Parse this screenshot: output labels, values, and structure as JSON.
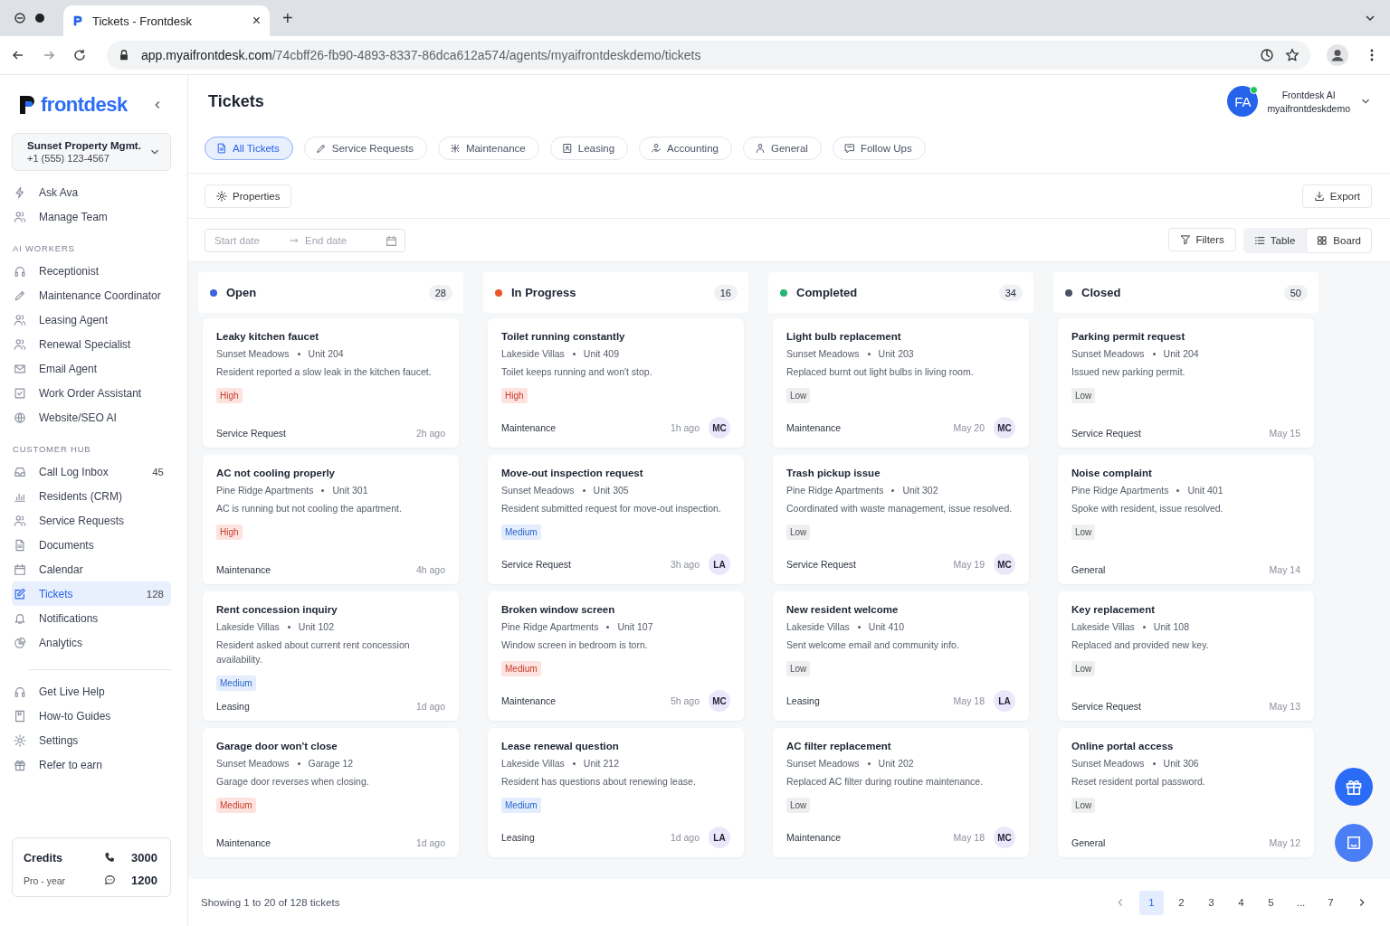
{
  "browser": {
    "tab_title": "Tickets - Frontdesk",
    "close": "×",
    "new_tab": "+",
    "url_host": "app.myaifrontdesk.com",
    "url_path": "/74cbff26-fb90-4893-8337-86dca612a574/agents/myaifrontdeskdemo/tickets"
  },
  "sidebar": {
    "logo": "frontdesk",
    "org": {
      "name": "Sunset Property Mgmt.",
      "phone": "+1 (555) 123-4567"
    },
    "top_items": [
      {
        "label": "Ask Ava",
        "selected": false
      },
      {
        "label": "Manage Team",
        "selected": false
      }
    ],
    "sections": [
      {
        "title": "AI WORKERS",
        "items": [
          {
            "label": "Receptionist",
            "selected": false
          },
          {
            "label": "Maintenance Coordinator",
            "selected": false
          },
          {
            "label": "Leasing Agent",
            "selected": false
          },
          {
            "label": "Renewal Specialist",
            "selected": false
          },
          {
            "label": "Email Agent",
            "selected": false
          },
          {
            "label": "Work Order Assistant",
            "selected": false
          },
          {
            "label": "Website/SEO AI",
            "selected": false
          }
        ]
      },
      {
        "title": "CUSTOMER HUB",
        "items": [
          {
            "label": "Call Log Inbox",
            "count": "45",
            "selected": false
          },
          {
            "label": "Residents (CRM)",
            "selected": false
          },
          {
            "label": "Service Requests",
            "selected": false
          },
          {
            "label": "Documents",
            "selected": false
          },
          {
            "label": "Calendar",
            "selected": false
          },
          {
            "label": "Tickets",
            "count": "128",
            "selected": true
          },
          {
            "label": "Notifications",
            "selected": false
          },
          {
            "label": "Analytics",
            "selected": false
          }
        ]
      }
    ],
    "bottom_items": [
      {
        "label": "Get Live Help",
        "selected": false
      },
      {
        "label": "How-to Guides",
        "selected": false
      },
      {
        "label": "Settings",
        "selected": false
      },
      {
        "label": "Refer to earn",
        "selected": false
      }
    ],
    "credits": {
      "title": "Credits",
      "plan": "Pro - year",
      "calls": "3000",
      "messages": "1200"
    }
  },
  "header": {
    "title": "Tickets",
    "user": {
      "initials": "FA",
      "name": "Frontdesk AI",
      "account": "myaifrontdeskdemo",
      "online": true
    }
  },
  "tabs": [
    {
      "label": "All Tickets",
      "selected": true
    },
    {
      "label": "Service Requests",
      "selected": false
    },
    {
      "label": "Maintenance",
      "selected": false
    },
    {
      "label": "Leasing",
      "selected": false
    },
    {
      "label": "Accounting",
      "selected": false
    },
    {
      "label": "General",
      "selected": false
    },
    {
      "label": "Follow Ups",
      "selected": false
    }
  ],
  "properties_button": "Properties",
  "export_button": "Export",
  "date_range": {
    "start_placeholder": "Start date",
    "end_placeholder": "End date"
  },
  "filters_button": "Filters",
  "views": [
    {
      "label": "Table",
      "selected": false
    },
    {
      "label": "Board",
      "selected": true
    }
  ],
  "columns": [
    {
      "title": "Open",
      "count": "28",
      "color": "#3b63e0",
      "cards": [
        {
          "title": "Leaky kitchen faucet",
          "property": "Sunset Meadows",
          "unit": "Unit 204",
          "description": "Resident reported a slow leak in the kitchen faucet.",
          "priority": "High",
          "color": "#fde3e0",
          "category": "Service Request",
          "time": "2h ago"
        },
        {
          "title": "AC not cooling properly",
          "property": "Pine Ridge Apartments",
          "unit": "Unit 301",
          "description": "AC is running but not cooling the apartment.",
          "priority": "High",
          "color": "#fde3e0",
          "category": "Maintenance",
          "time": "4h ago"
        },
        {
          "title": "Rent concession inquiry",
          "property": "Lakeside Villas",
          "unit": "Unit 102",
          "description": "Resident asked about current rent concession availability.",
          "priority": "Medium",
          "color": "#e3edfd",
          "category": "Leasing",
          "time": "1d ago"
        },
        {
          "title": "Garage door won't close",
          "property": "Sunset Meadows",
          "unit": "Garage 12",
          "description": "Garage door reverses when closing.",
          "priority": "Medium",
          "color": "#fde3e0",
          "category": "Maintenance",
          "time": "1d ago"
        }
      ]
    },
    {
      "title": "In Progress",
      "count": "16",
      "color": "#e8562a",
      "cards": [
        {
          "title": "Toilet running constantly",
          "property": "Lakeside Villas",
          "unit": "Unit 409",
          "description": "Toilet keeps running and won't stop.",
          "priority": "High",
          "color": "#fde3e0",
          "category": "Maintenance",
          "time": "1h ago",
          "assignee": "MC"
        },
        {
          "title": "Move-out inspection request",
          "property": "Sunset Meadows",
          "unit": "Unit 305",
          "description": "Resident submitted request for move-out inspection.",
          "priority": "Medium",
          "color": "#e3edfd",
          "category": "Service Request",
          "time": "3h ago",
          "assignee": "LA"
        },
        {
          "title": "Broken window screen",
          "property": "Pine Ridge Apartments",
          "unit": "Unit 107",
          "description": "Window screen in bedroom is torn.",
          "priority": "Medium",
          "color": "#fde3e0",
          "category": "Maintenance",
          "time": "5h ago",
          "assignee": "MC"
        },
        {
          "title": "Lease renewal question",
          "property": "Lakeside Villas",
          "unit": "Unit 212",
          "description": "Resident has questions about renewing lease.",
          "priority": "Medium",
          "color": "#e3edfd",
          "category": "Leasing",
          "time": "1d ago",
          "assignee": "LA"
        }
      ]
    },
    {
      "title": "Completed",
      "count": "34",
      "color": "#22b573",
      "cards": [
        {
          "title": "Light bulb replacement",
          "property": "Sunset Meadows",
          "unit": "Unit 203",
          "description": "Replaced burnt out light bulbs in living room.",
          "priority": "Low",
          "color": "#eeeff1",
          "category": "Maintenance",
          "time": "May 20",
          "assignee": "MC"
        },
        {
          "title": "Trash pickup issue",
          "property": "Pine Ridge Apartments",
          "unit": "Unit 302",
          "description": "Coordinated with waste management, issue resolved.",
          "priority": "Low",
          "color": "#eeeff1",
          "category": "Service Request",
          "time": "May 19",
          "assignee": "MC"
        },
        {
          "title": "New resident welcome",
          "property": "Lakeside Villas",
          "unit": "Unit 410",
          "description": "Sent welcome email and community info.",
          "priority": "Low",
          "color": "#eeeff1",
          "category": "Leasing",
          "time": "May 18",
          "assignee": "LA"
        },
        {
          "title": "AC filter replacement",
          "property": "Sunset Meadows",
          "unit": "Unit 202",
          "description": "Replaced AC filter during routine maintenance.",
          "priority": "Low",
          "color": "#eeeff1",
          "category": "Maintenance",
          "time": "May 18",
          "assignee": "MC"
        }
      ]
    },
    {
      "title": "Closed",
      "count": "50",
      "color": "#4b5263",
      "cards": [
        {
          "title": "Parking permit request",
          "property": "Sunset Meadows",
          "unit": "Unit 204",
          "description": "Issued new parking permit.",
          "priority": "Low",
          "color": "#eeeff1",
          "category": "Service Request",
          "time": "May 15"
        },
        {
          "title": "Noise complaint",
          "property": "Pine Ridge Apartments",
          "unit": "Unit 401",
          "description": "Spoke with resident, issue resolved.",
          "priority": "Low",
          "color": "#eeeff1",
          "category": "General",
          "time": "May 14"
        },
        {
          "title": "Key replacement",
          "property": "Lakeside Villas",
          "unit": "Unit 108",
          "description": "Replaced and provided new key.",
          "priority": "Low",
          "color": "#eeeff1",
          "category": "Service Request",
          "time": "May 13"
        },
        {
          "title": "Online portal access",
          "property": "Sunset Meadows",
          "unit": "Unit 306",
          "description": "Reset resident portal password.",
          "priority": "Low",
          "color": "#eeeff1",
          "category": "General",
          "time": "May 12"
        }
      ]
    }
  ],
  "footer": {
    "summary": "Showing 1 to 20 of 128 tickets",
    "pages": [
      {
        "label": "1",
        "selected": true
      },
      {
        "label": "2",
        "selected": false
      },
      {
        "label": "3",
        "selected": false
      },
      {
        "label": "4",
        "selected": false
      },
      {
        "label": "5",
        "selected": false
      },
      {
        "label": "...",
        "selected": false
      },
      {
        "label": "7",
        "selected": false
      }
    ]
  }
}
